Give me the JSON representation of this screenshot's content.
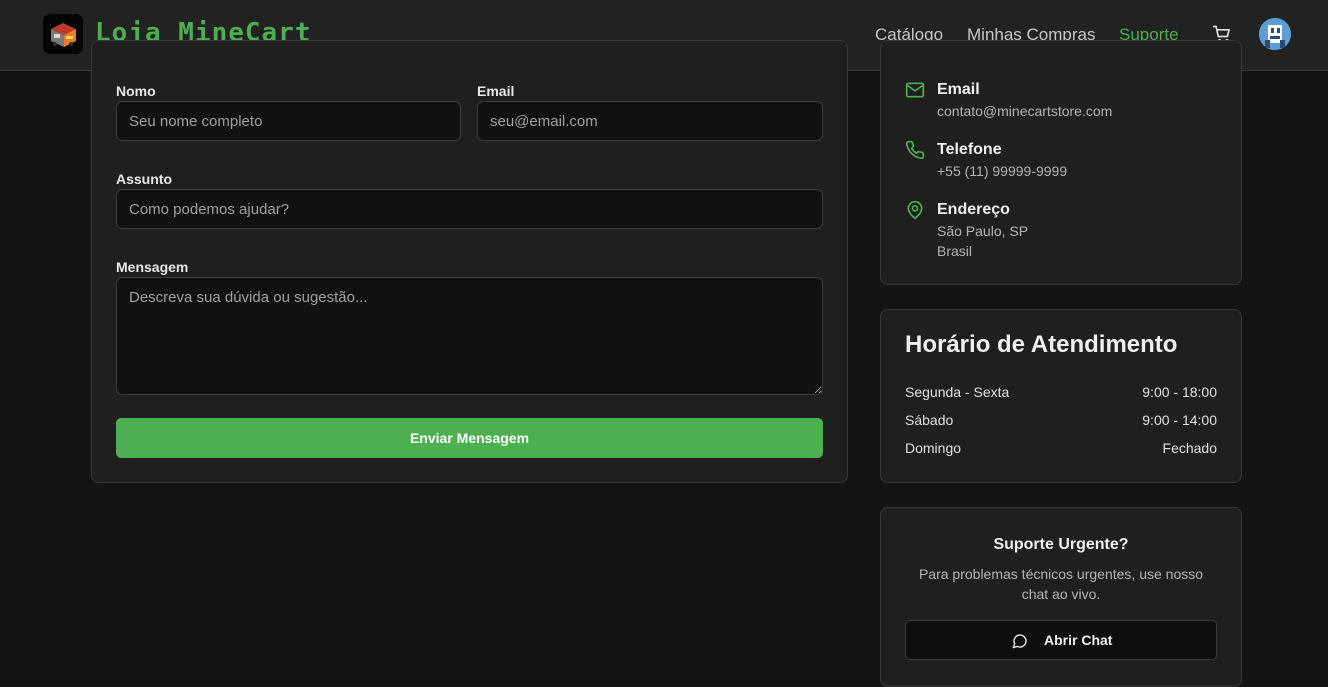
{
  "header": {
    "brand": "Loja MineCart",
    "nav": [
      {
        "label": "Catálogo",
        "active": false
      },
      {
        "label": "Minhas Compras",
        "active": false
      },
      {
        "label": "Suporte",
        "active": true
      }
    ],
    "cart_icon": "cart-icon",
    "avatar_icon": "user-avatar"
  },
  "form": {
    "name_label": "Nomo",
    "name_placeholder": "Seu nome completo",
    "email_label": "Email",
    "email_placeholder": "seu@email.com",
    "subject_label": "Assunto",
    "subject_placeholder": "Como podemos ajudar?",
    "message_label": "Mensagem",
    "message_placeholder": "Descreva sua dúvida ou sugestão...",
    "submit_label": "Enviar Mensagem"
  },
  "contact": {
    "email_title": "Email",
    "email_value": "contato@minecartstore.com",
    "phone_title": "Telefone",
    "phone_value": "+55 (11) 99999-9999",
    "address_title": "Endereço",
    "address_line1": "São Paulo, SP",
    "address_line2": "Brasil"
  },
  "hours": {
    "title": "Horário de Atendimento",
    "rows": [
      {
        "day": "Segunda - Sexta",
        "time": "9:00 - 18:00"
      },
      {
        "day": "Sábado",
        "time": "9:00 - 14:00"
      },
      {
        "day": "Domingo",
        "time": "Fechado"
      }
    ]
  },
  "urgent": {
    "title": "Suporte Urgente?",
    "text": "Para problemas técnicos urgentes, use nosso chat ao vivo.",
    "button_label": "Abrir Chat"
  },
  "colors": {
    "accent": "#4caf50",
    "background": "#141414",
    "card": "#1f1f1f"
  }
}
